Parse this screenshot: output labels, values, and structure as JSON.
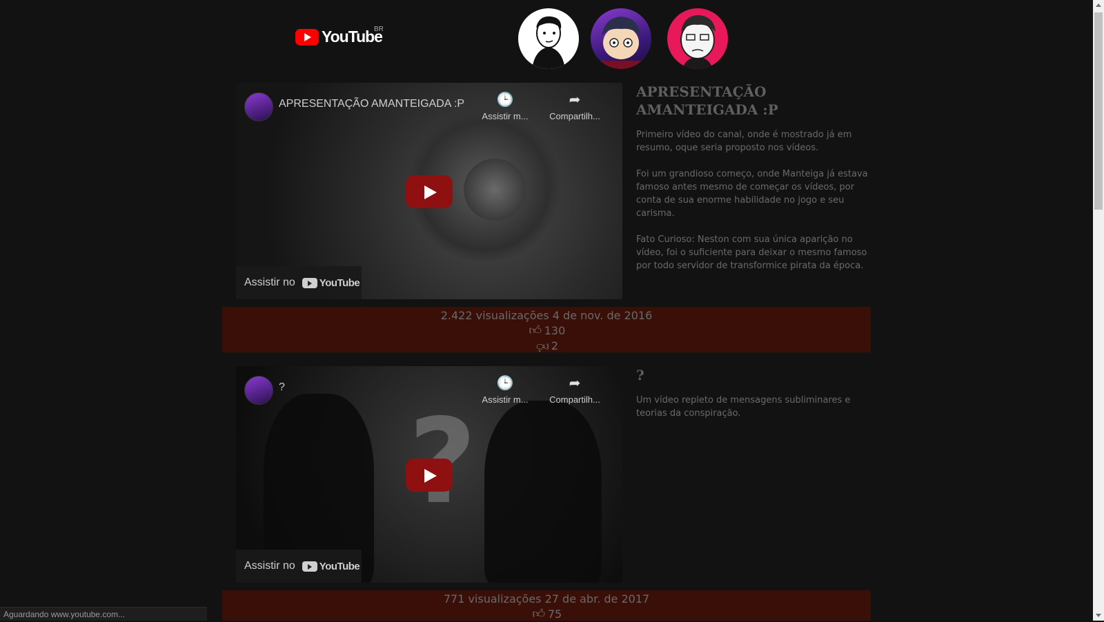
{
  "header": {
    "logo_text": "YouTube",
    "logo_region": "BR",
    "avatars": [
      "avatar-1",
      "avatar-2",
      "avatar-3"
    ]
  },
  "videos": [
    {
      "embed_title": "APRESENTAÇÃO AMANTEIGADA :P",
      "watch_later": "Assistir m...",
      "share": "Compartilh...",
      "watch_on": "Assistir no",
      "watch_on_brand": "YouTube",
      "title": "APRESENTAÇÃO AMANTEIGADA :P",
      "paragraphs": [
        "Primeiro vídeo do canal, onde é mostrado já em resumo, oque seria proposto nos vídeos.",
        "Foi um grandioso começo, onde Manteiga já estava famoso antes mesmo de começar os vídeos, por conta de sua enorme habilidade no jogo e seu carisma.",
        "Fato Curioso: Neston com sua única aparição no vídeo, foi o suficiente para deixar o mesmo famoso por todo servidor de transformice pirata da época."
      ],
      "stats": "2.422 visualizações 4 de nov. de 2016",
      "likes": "130",
      "dislikes": "2"
    },
    {
      "embed_title": "?",
      "watch_later": "Assistir m...",
      "share": "Compartilh...",
      "watch_on": "Assistir no",
      "watch_on_brand": "YouTube",
      "title": "?",
      "paragraphs": [
        "Um vídeo repleto de mensagens subliminares e teorias da conspiração."
      ],
      "stats": "771 visualizações 27 de abr. de 2017",
      "likes": "75"
    }
  ],
  "status_bar": "Aguardando www.youtube.com...",
  "colors": {
    "page_bg": "#121212",
    "stats_bg": "#3a0f07",
    "brand_red": "#ff0000"
  }
}
